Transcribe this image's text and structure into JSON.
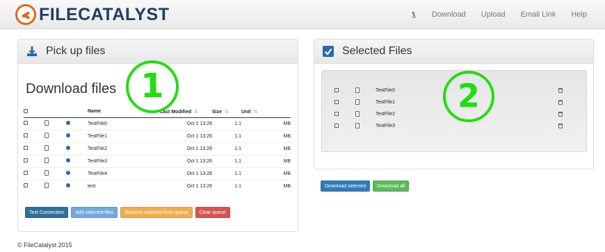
{
  "brand": {
    "name": "FILECATALYST"
  },
  "nav": {
    "key_icon": "key-icon",
    "items": [
      "Download",
      "Upload",
      "Email Link",
      "Help"
    ]
  },
  "pickup": {
    "title": "Pick up files",
    "heading": "Download files",
    "columns": [
      "Name",
      "Last Modified",
      "Size",
      "Unit"
    ],
    "rows": [
      {
        "name": "TestFile0",
        "modified": "Oct 1 13:26",
        "size": "1.1",
        "unit": "MB"
      },
      {
        "name": "TestFile1",
        "modified": "Oct 1 13:26",
        "size": "1.1",
        "unit": "MB"
      },
      {
        "name": "TestFile2",
        "modified": "Oct 1 13:26",
        "size": "1.1",
        "unit": "MB"
      },
      {
        "name": "TestFile3",
        "modified": "Oct 1 13:26",
        "size": "1.1",
        "unit": "MB"
      },
      {
        "name": "TestFile4",
        "modified": "Oct 1 13:26",
        "size": "1.1",
        "unit": "MB"
      },
      {
        "name": "test",
        "modified": "Oct 1 13:26",
        "size": "1.1",
        "unit": "MB"
      }
    ],
    "buttons": {
      "test": "Test Connection",
      "add": "Add selected files",
      "remove": "Remove selected from queue",
      "clear": "Clear queue"
    }
  },
  "selected": {
    "title": "Selected Files",
    "files": [
      "TestFile0",
      "TestFile1",
      "TestFile2",
      "TestFile3"
    ],
    "download_selected": "Download selected",
    "download_all": "Download all"
  },
  "footer": "© FileCatalyst 2015",
  "annotations": [
    "1",
    "2"
  ],
  "colors": {
    "brand_orange": "#e8641b",
    "brand_navy": "#1f3e66",
    "link_blue": "#2a6aa6",
    "marker_green": "#22dd11"
  }
}
